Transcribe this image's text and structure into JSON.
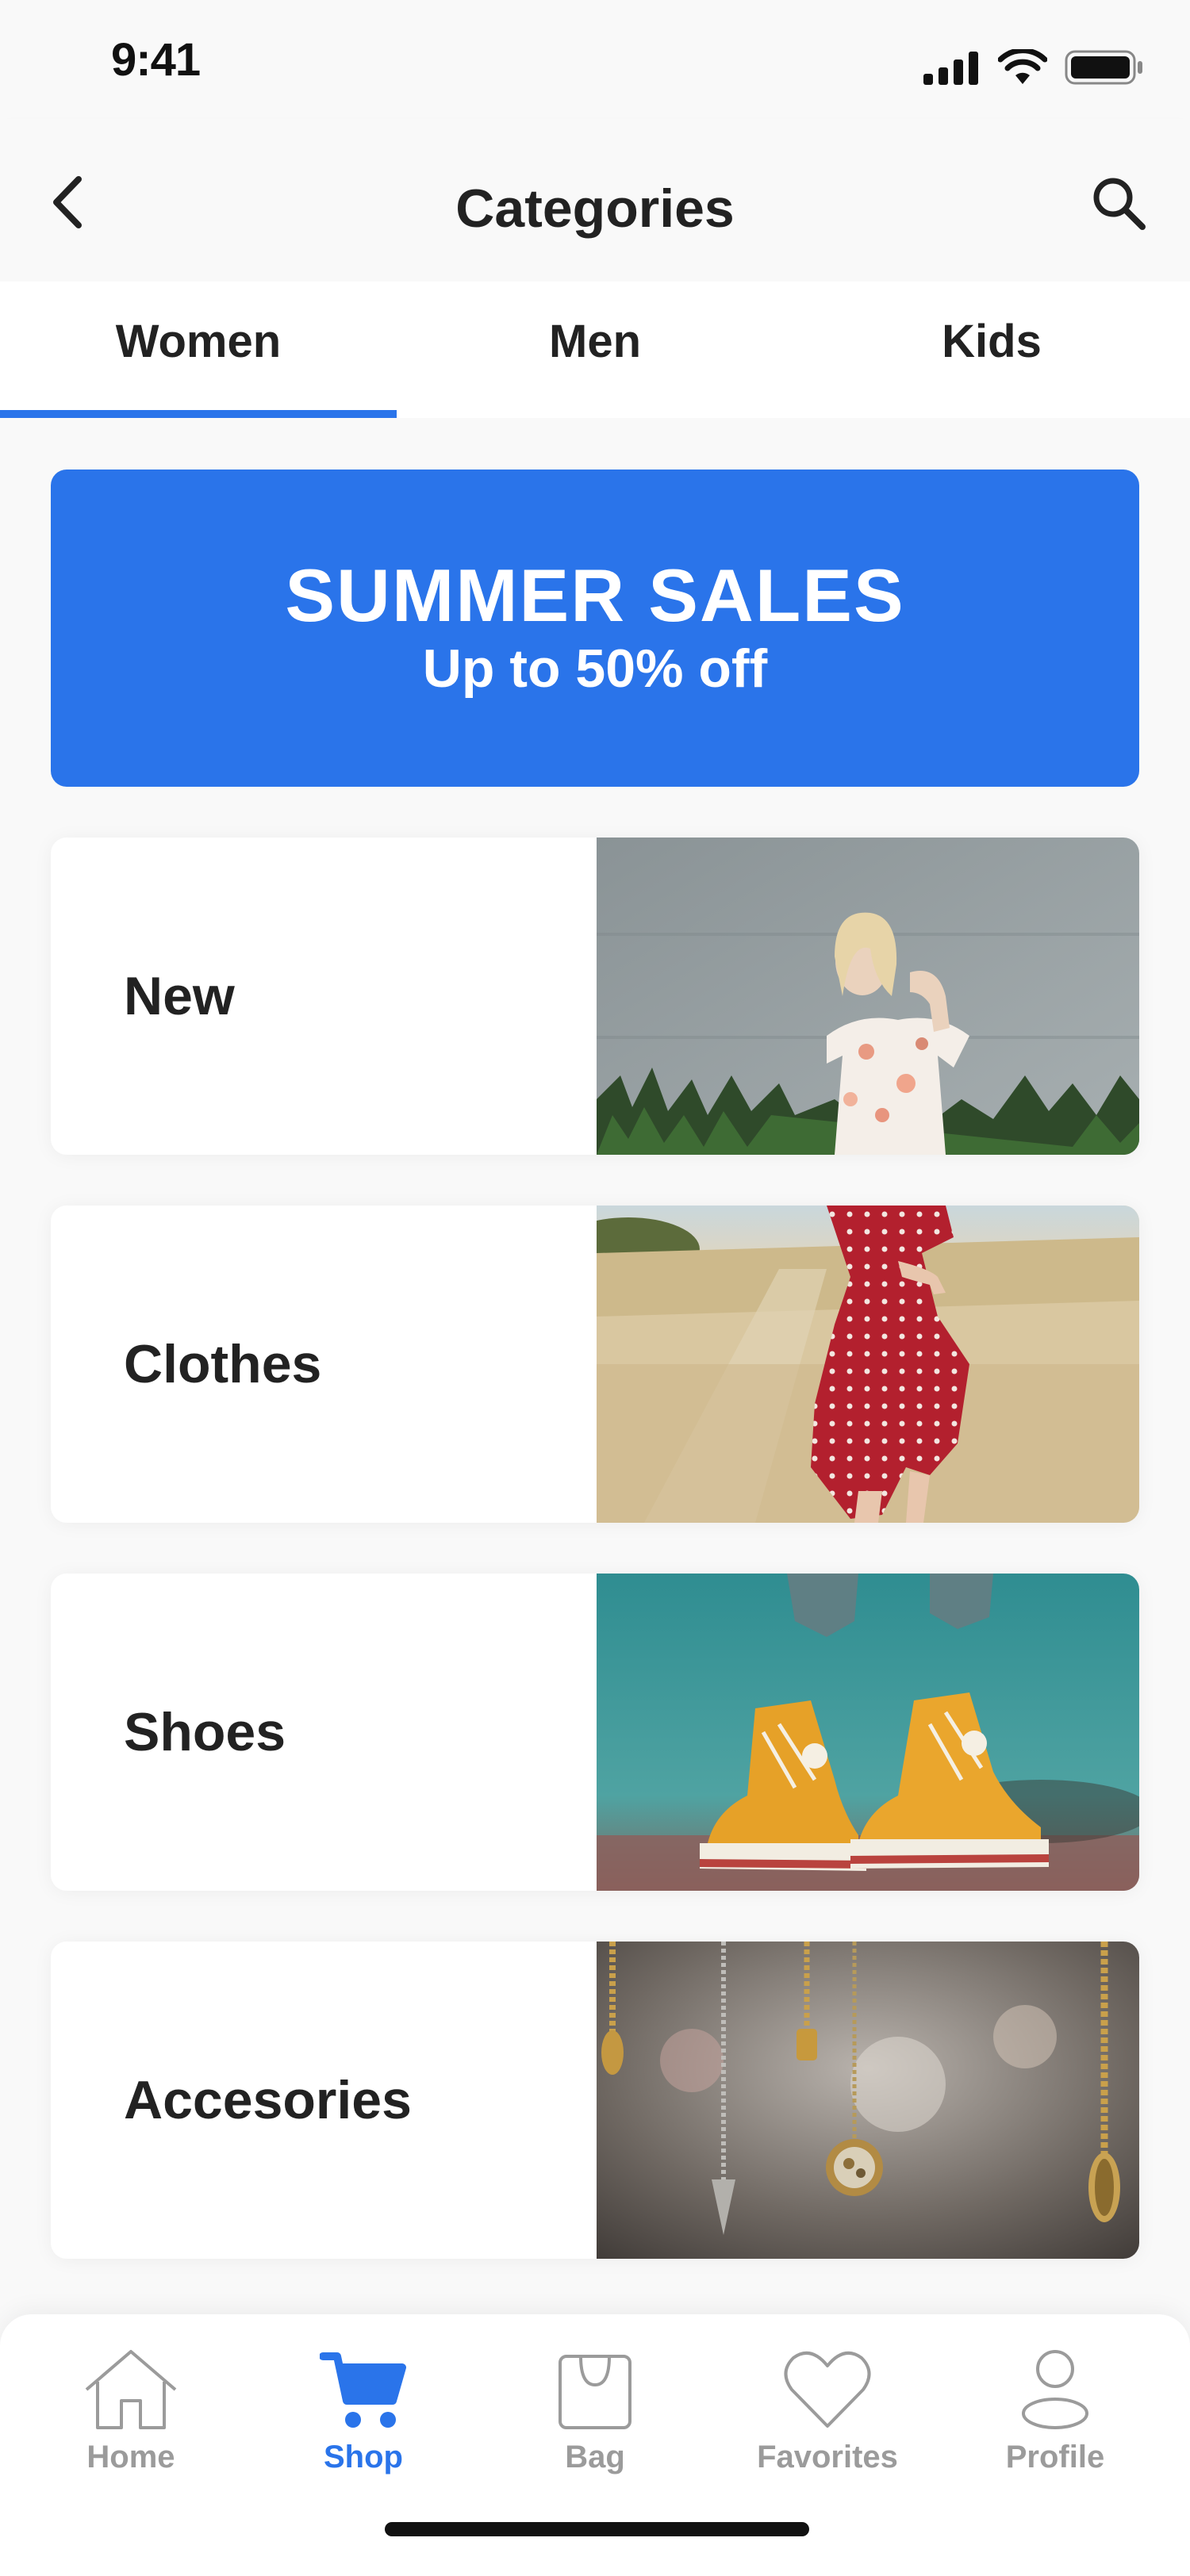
{
  "status_bar": {
    "time": "9:41"
  },
  "header": {
    "title": "Categories"
  },
  "tabs": [
    {
      "label": "Women",
      "active": true
    },
    {
      "label": "Men",
      "active": false
    },
    {
      "label": "Kids",
      "active": false
    }
  ],
  "banner": {
    "title": "SUMMER SALES",
    "subtitle": "Up to 50% off"
  },
  "categories": [
    {
      "label": "New",
      "image": "woman-floral-dress-photo"
    },
    {
      "label": "Clothes",
      "image": "red-polka-dot-dress-photo"
    },
    {
      "label": "Shoes",
      "image": "yellow-sneakers-photo"
    },
    {
      "label": "Accesories",
      "image": "hanging-necklaces-photo"
    }
  ],
  "tabbar": {
    "items": [
      {
        "label": "Home",
        "icon": "home-icon",
        "active": false
      },
      {
        "label": "Shop",
        "icon": "cart-icon",
        "active": true
      },
      {
        "label": "Bag",
        "icon": "bag-icon",
        "active": false
      },
      {
        "label": "Favorites",
        "icon": "heart-icon",
        "active": false
      },
      {
        "label": "Profile",
        "icon": "profile-icon",
        "active": false
      }
    ]
  },
  "colors": {
    "accent": "#2a74ea",
    "text": "#222222",
    "inactive": "#9b9b9b",
    "background": "#f9f9f9"
  }
}
